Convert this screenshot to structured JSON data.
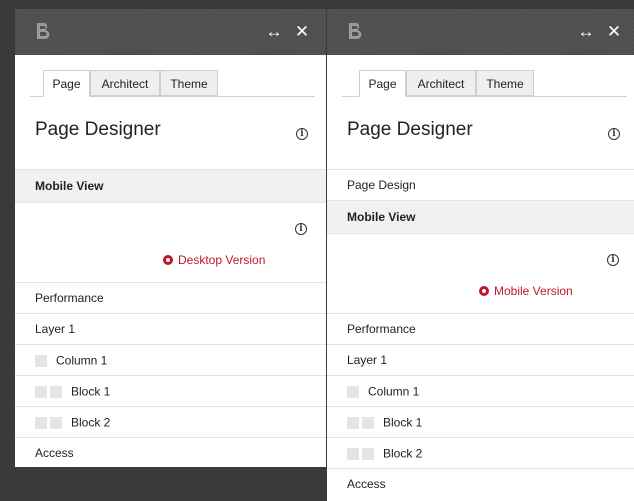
{
  "panels": [
    {
      "tabs": [
        "Page",
        "Architect",
        "Theme"
      ],
      "active_tab": "Page",
      "title": "Page Designer",
      "pre_rows": [],
      "section": "Mobile View",
      "version_link": "Desktop Version",
      "rows": [
        {
          "label": "Performance",
          "boxes": 0
        },
        {
          "label": "Layer 1",
          "boxes": 0
        },
        {
          "label": "Column 1",
          "boxes": 1
        },
        {
          "label": "Block 1",
          "boxes": 2
        },
        {
          "label": "Block 2",
          "boxes": 2
        },
        {
          "label": "Access",
          "boxes": 0
        }
      ]
    },
    {
      "tabs": [
        "Page",
        "Architect",
        "Theme"
      ],
      "active_tab": "Page",
      "title": "Page Designer",
      "pre_rows": [
        "Page Design"
      ],
      "section": "Mobile View",
      "version_link": "Mobile Version",
      "rows": [
        {
          "label": "Performance",
          "boxes": 0
        },
        {
          "label": "Layer 1",
          "boxes": 0
        },
        {
          "label": "Column 1",
          "boxes": 1
        },
        {
          "label": "Block 1",
          "boxes": 2
        },
        {
          "label": "Block 2",
          "boxes": 2
        },
        {
          "label": "Access",
          "boxes": 0
        }
      ]
    }
  ],
  "titlebar": {
    "logo_icon": "brand-logo-icon",
    "expand_icon": "arrows-horizontal-icon",
    "close_icon": "close-icon",
    "expand_glyph": "↔",
    "close_glyph": "✕"
  },
  "colors": {
    "titlebar": "#4d4d4d",
    "accent": "#c0172e",
    "section_bg": "#f1f1f3",
    "tree_box": "#e4e4e4"
  }
}
